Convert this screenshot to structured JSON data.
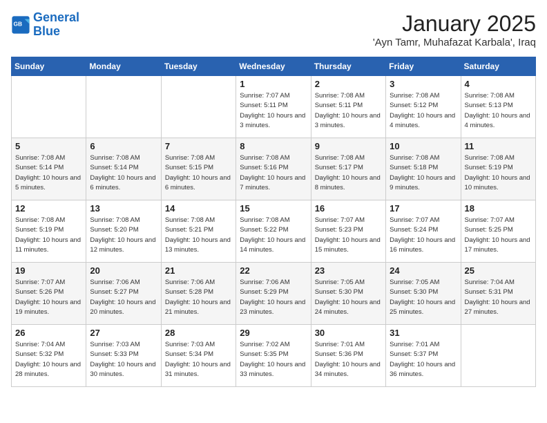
{
  "header": {
    "logo_text_general": "General",
    "logo_text_blue": "Blue",
    "title": "January 2025",
    "subtitle": "'Ayn Tamr, Muhafazat Karbala', Iraq"
  },
  "weekdays": [
    "Sunday",
    "Monday",
    "Tuesday",
    "Wednesday",
    "Thursday",
    "Friday",
    "Saturday"
  ],
  "weeks": [
    [
      {
        "day": "",
        "sunrise": "",
        "sunset": "",
        "daylight": ""
      },
      {
        "day": "",
        "sunrise": "",
        "sunset": "",
        "daylight": ""
      },
      {
        "day": "",
        "sunrise": "",
        "sunset": "",
        "daylight": ""
      },
      {
        "day": "1",
        "sunrise": "Sunrise: 7:07 AM",
        "sunset": "Sunset: 5:11 PM",
        "daylight": "Daylight: 10 hours and 3 minutes."
      },
      {
        "day": "2",
        "sunrise": "Sunrise: 7:08 AM",
        "sunset": "Sunset: 5:11 PM",
        "daylight": "Daylight: 10 hours and 3 minutes."
      },
      {
        "day": "3",
        "sunrise": "Sunrise: 7:08 AM",
        "sunset": "Sunset: 5:12 PM",
        "daylight": "Daylight: 10 hours and 4 minutes."
      },
      {
        "day": "4",
        "sunrise": "Sunrise: 7:08 AM",
        "sunset": "Sunset: 5:13 PM",
        "daylight": "Daylight: 10 hours and 4 minutes."
      }
    ],
    [
      {
        "day": "5",
        "sunrise": "Sunrise: 7:08 AM",
        "sunset": "Sunset: 5:14 PM",
        "daylight": "Daylight: 10 hours and 5 minutes."
      },
      {
        "day": "6",
        "sunrise": "Sunrise: 7:08 AM",
        "sunset": "Sunset: 5:14 PM",
        "daylight": "Daylight: 10 hours and 6 minutes."
      },
      {
        "day": "7",
        "sunrise": "Sunrise: 7:08 AM",
        "sunset": "Sunset: 5:15 PM",
        "daylight": "Daylight: 10 hours and 6 minutes."
      },
      {
        "day": "8",
        "sunrise": "Sunrise: 7:08 AM",
        "sunset": "Sunset: 5:16 PM",
        "daylight": "Daylight: 10 hours and 7 minutes."
      },
      {
        "day": "9",
        "sunrise": "Sunrise: 7:08 AM",
        "sunset": "Sunset: 5:17 PM",
        "daylight": "Daylight: 10 hours and 8 minutes."
      },
      {
        "day": "10",
        "sunrise": "Sunrise: 7:08 AM",
        "sunset": "Sunset: 5:18 PM",
        "daylight": "Daylight: 10 hours and 9 minutes."
      },
      {
        "day": "11",
        "sunrise": "Sunrise: 7:08 AM",
        "sunset": "Sunset: 5:19 PM",
        "daylight": "Daylight: 10 hours and 10 minutes."
      }
    ],
    [
      {
        "day": "12",
        "sunrise": "Sunrise: 7:08 AM",
        "sunset": "Sunset: 5:19 PM",
        "daylight": "Daylight: 10 hours and 11 minutes."
      },
      {
        "day": "13",
        "sunrise": "Sunrise: 7:08 AM",
        "sunset": "Sunset: 5:20 PM",
        "daylight": "Daylight: 10 hours and 12 minutes."
      },
      {
        "day": "14",
        "sunrise": "Sunrise: 7:08 AM",
        "sunset": "Sunset: 5:21 PM",
        "daylight": "Daylight: 10 hours and 13 minutes."
      },
      {
        "day": "15",
        "sunrise": "Sunrise: 7:08 AM",
        "sunset": "Sunset: 5:22 PM",
        "daylight": "Daylight: 10 hours and 14 minutes."
      },
      {
        "day": "16",
        "sunrise": "Sunrise: 7:07 AM",
        "sunset": "Sunset: 5:23 PM",
        "daylight": "Daylight: 10 hours and 15 minutes."
      },
      {
        "day": "17",
        "sunrise": "Sunrise: 7:07 AM",
        "sunset": "Sunset: 5:24 PM",
        "daylight": "Daylight: 10 hours and 16 minutes."
      },
      {
        "day": "18",
        "sunrise": "Sunrise: 7:07 AM",
        "sunset": "Sunset: 5:25 PM",
        "daylight": "Daylight: 10 hours and 17 minutes."
      }
    ],
    [
      {
        "day": "19",
        "sunrise": "Sunrise: 7:07 AM",
        "sunset": "Sunset: 5:26 PM",
        "daylight": "Daylight: 10 hours and 19 minutes."
      },
      {
        "day": "20",
        "sunrise": "Sunrise: 7:06 AM",
        "sunset": "Sunset: 5:27 PM",
        "daylight": "Daylight: 10 hours and 20 minutes."
      },
      {
        "day": "21",
        "sunrise": "Sunrise: 7:06 AM",
        "sunset": "Sunset: 5:28 PM",
        "daylight": "Daylight: 10 hours and 21 minutes."
      },
      {
        "day": "22",
        "sunrise": "Sunrise: 7:06 AM",
        "sunset": "Sunset: 5:29 PM",
        "daylight": "Daylight: 10 hours and 23 minutes."
      },
      {
        "day": "23",
        "sunrise": "Sunrise: 7:05 AM",
        "sunset": "Sunset: 5:30 PM",
        "daylight": "Daylight: 10 hours and 24 minutes."
      },
      {
        "day": "24",
        "sunrise": "Sunrise: 7:05 AM",
        "sunset": "Sunset: 5:30 PM",
        "daylight": "Daylight: 10 hours and 25 minutes."
      },
      {
        "day": "25",
        "sunrise": "Sunrise: 7:04 AM",
        "sunset": "Sunset: 5:31 PM",
        "daylight": "Daylight: 10 hours and 27 minutes."
      }
    ],
    [
      {
        "day": "26",
        "sunrise": "Sunrise: 7:04 AM",
        "sunset": "Sunset: 5:32 PM",
        "daylight": "Daylight: 10 hours and 28 minutes."
      },
      {
        "day": "27",
        "sunrise": "Sunrise: 7:03 AM",
        "sunset": "Sunset: 5:33 PM",
        "daylight": "Daylight: 10 hours and 30 minutes."
      },
      {
        "day": "28",
        "sunrise": "Sunrise: 7:03 AM",
        "sunset": "Sunset: 5:34 PM",
        "daylight": "Daylight: 10 hours and 31 minutes."
      },
      {
        "day": "29",
        "sunrise": "Sunrise: 7:02 AM",
        "sunset": "Sunset: 5:35 PM",
        "daylight": "Daylight: 10 hours and 33 minutes."
      },
      {
        "day": "30",
        "sunrise": "Sunrise: 7:01 AM",
        "sunset": "Sunset: 5:36 PM",
        "daylight": "Daylight: 10 hours and 34 minutes."
      },
      {
        "day": "31",
        "sunrise": "Sunrise: 7:01 AM",
        "sunset": "Sunset: 5:37 PM",
        "daylight": "Daylight: 10 hours and 36 minutes."
      },
      {
        "day": "",
        "sunrise": "",
        "sunset": "",
        "daylight": ""
      }
    ]
  ]
}
